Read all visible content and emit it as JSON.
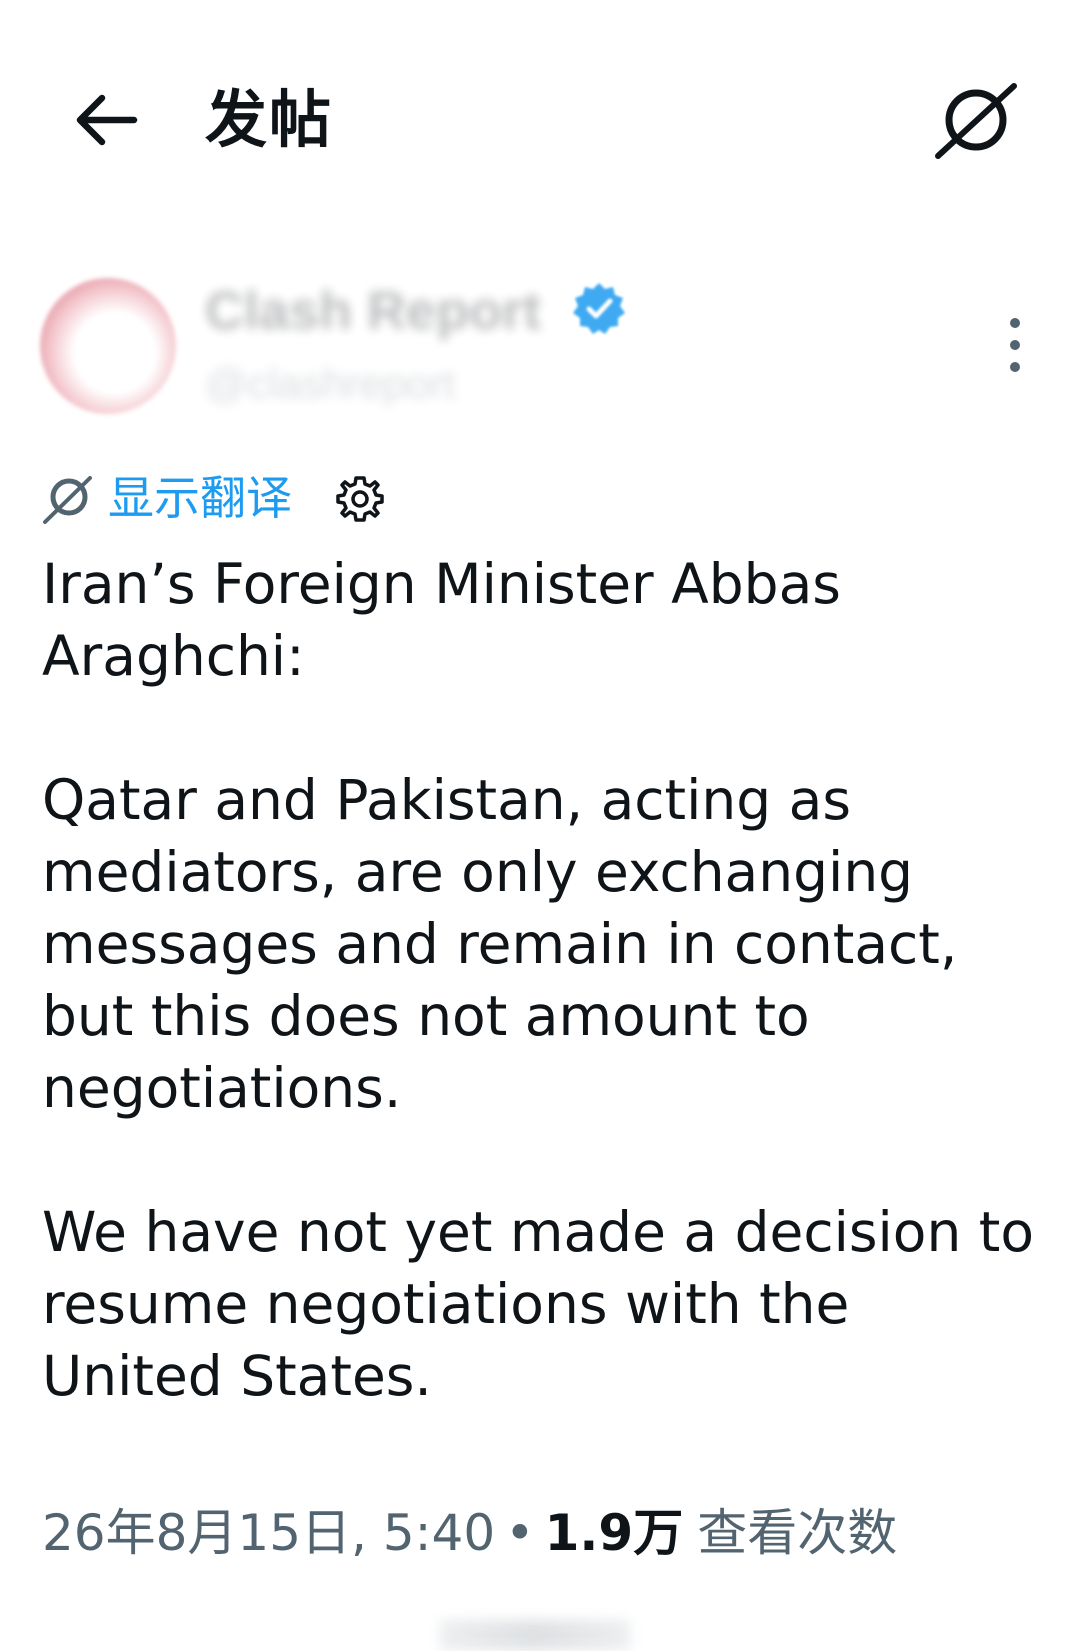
{
  "header": {
    "title": "发帖",
    "back_icon": "arrow-left-icon",
    "translate_icon": "translate-slash-icon"
  },
  "author": {
    "display_name": "Clash Report",
    "handle": "@clashreport",
    "verified": true,
    "badge_color": "#1d9bf0"
  },
  "translate": {
    "link_label": "显示翻译"
  },
  "tweet": {
    "paragraphs": [
      "Iran’s Foreign Minister Abbas Araghchi:",
      "Qatar and Pakistan, acting as mediators, are only exchanging messages and remain in contact, but this does not amount to negotiations.",
      "We have not yet made a decision to resume negotiations with the United States."
    ]
  },
  "meta": {
    "timestamp": "26年8月15日, 5:40",
    "separator": "•",
    "views_count": "1.9万",
    "views_label": "查看次数"
  },
  "colors": {
    "accent": "#1d9bf0",
    "text": "#0f1419",
    "secondary": "#536471"
  }
}
